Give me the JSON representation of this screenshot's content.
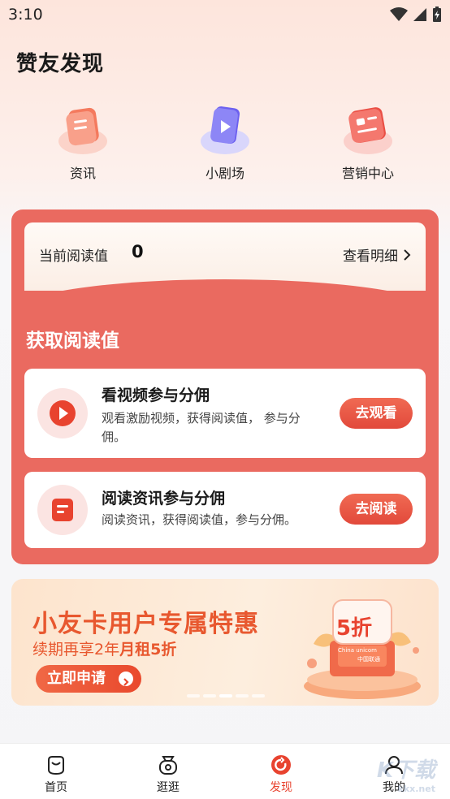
{
  "status_bar": {
    "time": "3:10"
  },
  "page_title": "赞友发现",
  "quick_entries": [
    {
      "label": "资讯",
      "icon": "news-icon"
    },
    {
      "label": "小剧场",
      "icon": "video-play-icon"
    },
    {
      "label": "营销中心",
      "icon": "marketing-icon"
    }
  ],
  "read_card": {
    "current_label": "当前阅读值",
    "current_value": "0",
    "detail_link": "查看明细",
    "earn_title": "获取阅读值",
    "tasks": [
      {
        "title": "看视频参与分佣",
        "desc": "观看激励视频，获得阅读值， 参与分佣。",
        "button": "去观看",
        "icon": "play-icon"
      },
      {
        "title": "阅读资讯参与分佣",
        "desc": "阅读资讯，获得阅读值，参与分佣。",
        "button": "去阅读",
        "icon": "article-icon"
      }
    ]
  },
  "banner": {
    "title": "小友卡用户专属特惠",
    "sub_prefix": "续期再享2年",
    "sub_bold": "月租5折",
    "button": "立即申请",
    "tag": "5折",
    "brand_en": "China unicom",
    "brand_cn": "中国联通",
    "slides": 5,
    "active_slide": 3
  },
  "tab_bar": [
    {
      "label": "首页",
      "icon": "home-icon",
      "active": false
    },
    {
      "label": "逛逛",
      "icon": "browse-icon",
      "active": false
    },
    {
      "label": "发现",
      "icon": "discover-icon",
      "active": true
    },
    {
      "label": "我的",
      "icon": "profile-icon",
      "active": false
    }
  ],
  "watermark": {
    "text": "K下载",
    "url": "kkx.net"
  },
  "colors": {
    "primary": "#e8432f",
    "card_red": "#ea6a60",
    "banner_orange": "#e8582f"
  }
}
